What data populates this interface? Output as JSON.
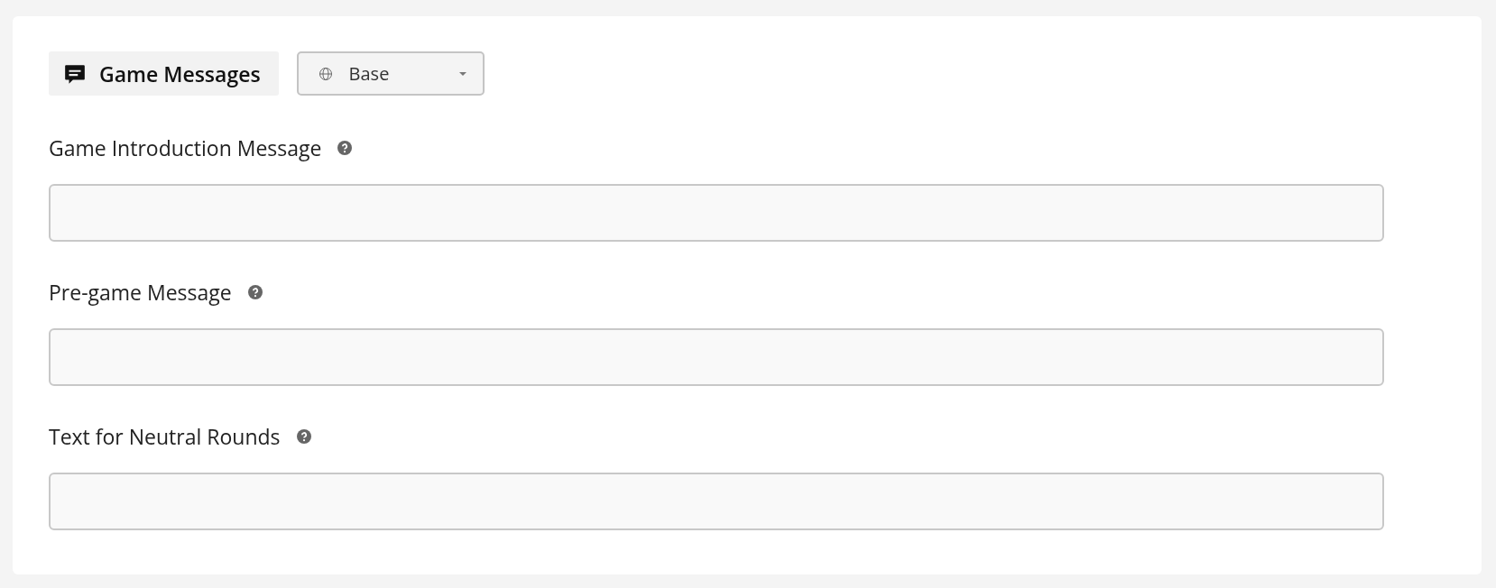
{
  "header": {
    "title": "Game Messages",
    "language": "Base"
  },
  "fields": [
    {
      "label": "Game Introduction Message"
    },
    {
      "label": "Pre-game Message"
    },
    {
      "label": "Text for Neutral Rounds"
    }
  ]
}
